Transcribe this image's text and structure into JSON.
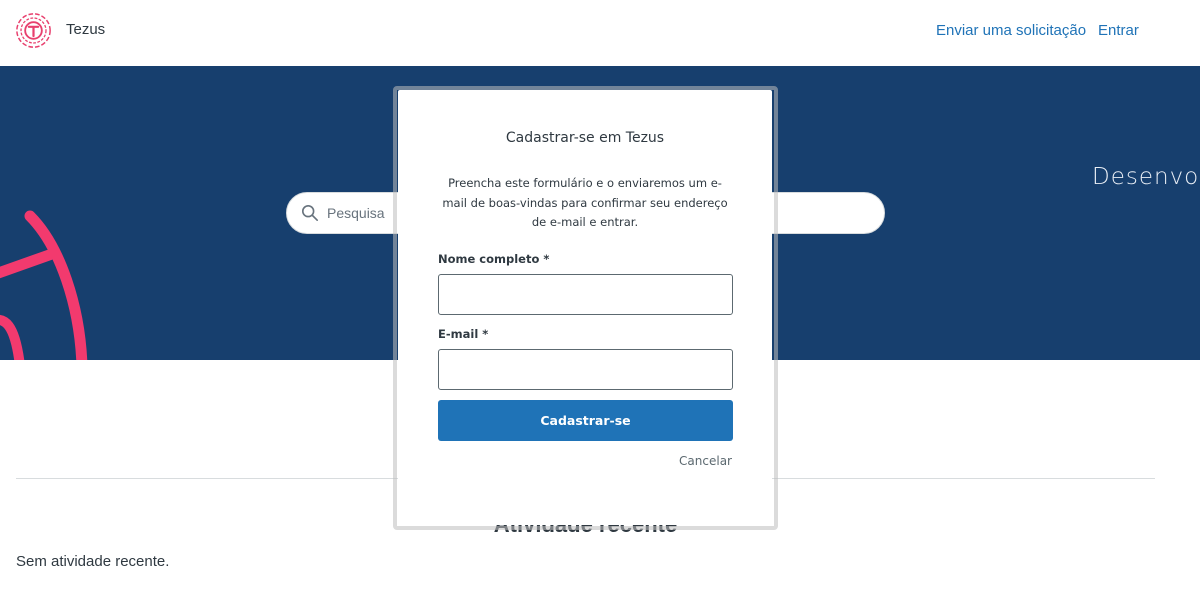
{
  "header": {
    "brand": "Tezus",
    "nav": {
      "submit_request": "Enviar uma solicitação",
      "sign_in": "Entrar"
    },
    "colors": {
      "link": "#1f73b7",
      "logo": "#e8406e"
    }
  },
  "hero": {
    "tagline": "Desenvol",
    "search": {
      "placeholder": "Pesquisa"
    },
    "colors": {
      "background": "#173f6e",
      "accent": "#f23a6e"
    }
  },
  "main": {
    "section_title": "Atividade recente",
    "empty_text": "Sem atividade recente."
  },
  "modal": {
    "title": "Cadastrar-se em Tezus",
    "description": "Preencha este formulário e o enviaremos um e-mail de boas-vindas para confirmar seu endereço de e-mail e entrar.",
    "fields": {
      "name": {
        "label": "Nome completo *",
        "value": ""
      },
      "email": {
        "label": "E-mail *",
        "value": ""
      }
    },
    "submit_label": "Cadastrar-se",
    "cancel_label": "Cancelar",
    "colors": {
      "primary_button": "#1f73b7"
    }
  }
}
